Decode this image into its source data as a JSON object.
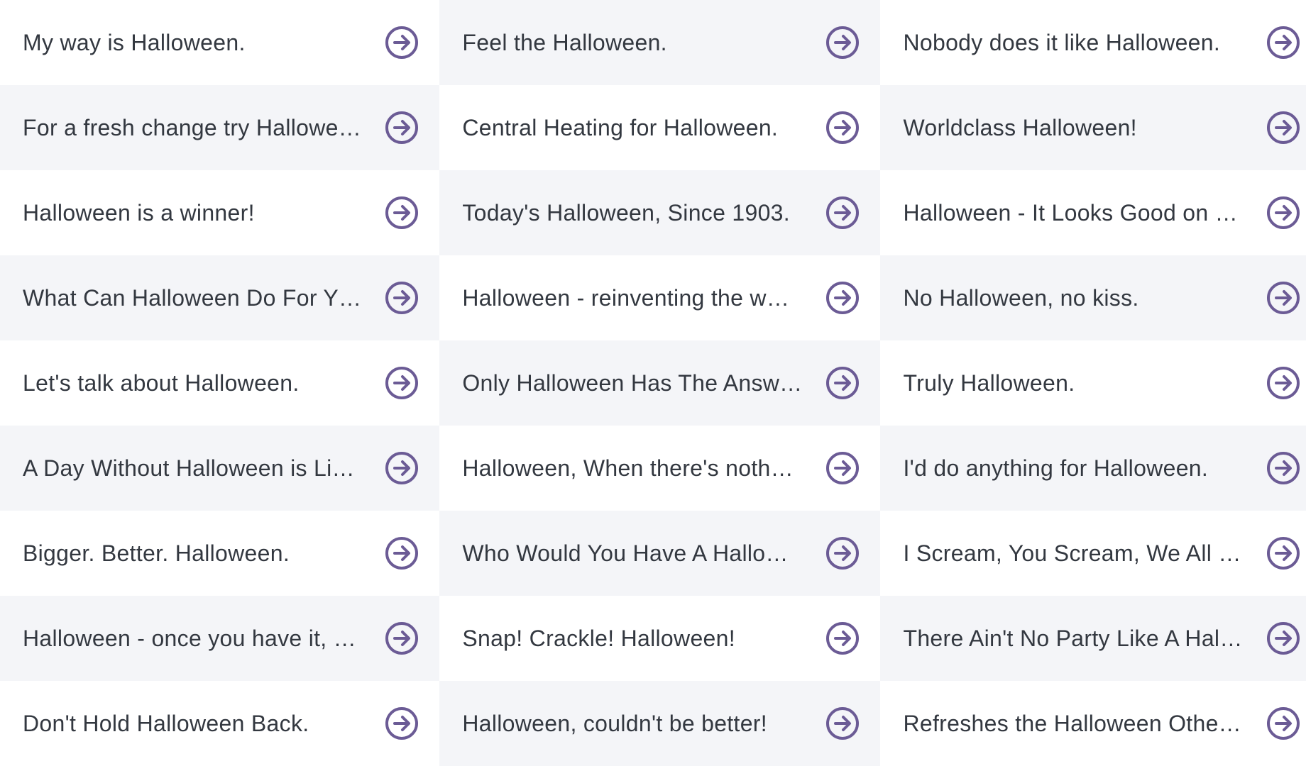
{
  "theme": {
    "accent": "#6b5b95",
    "text": "#333840",
    "row_shade": "#f4f5f8",
    "row_plain": "#ffffff"
  },
  "icon": "arrow-right-circle-icon",
  "slogans": [
    [
      "My way is Halloween.",
      "Feel the Halloween.",
      "Nobody does it like Halloween."
    ],
    [
      "For a fresh change try Hallowe…",
      "Central Heating for Halloween.",
      "Worldclass Halloween!"
    ],
    [
      "Halloween is a winner!",
      "Today's Halloween, Since 1903.",
      "Halloween - It Looks Good on …"
    ],
    [
      "What Can Halloween Do For Y…",
      "Halloween - reinventing the w…",
      "No Halloween, no kiss."
    ],
    [
      "Let's talk about Halloween.",
      "Only Halloween Has The Answ…",
      "Truly Halloween."
    ],
    [
      "A Day Without Halloween is Li…",
      "Halloween, When there's noth…",
      "I'd do anything for Halloween."
    ],
    [
      "Bigger. Better. Halloween.",
      "Who Would You Have A Hallo…",
      "I Scream, You Scream, We All …"
    ],
    [
      "Halloween - once you have it, …",
      "Snap! Crackle! Halloween!",
      "There Ain't No Party Like A Hal…"
    ],
    [
      "Don't Hold Halloween Back.",
      "Halloween, couldn't be better!",
      "Refreshes the Halloween Othe…"
    ]
  ]
}
